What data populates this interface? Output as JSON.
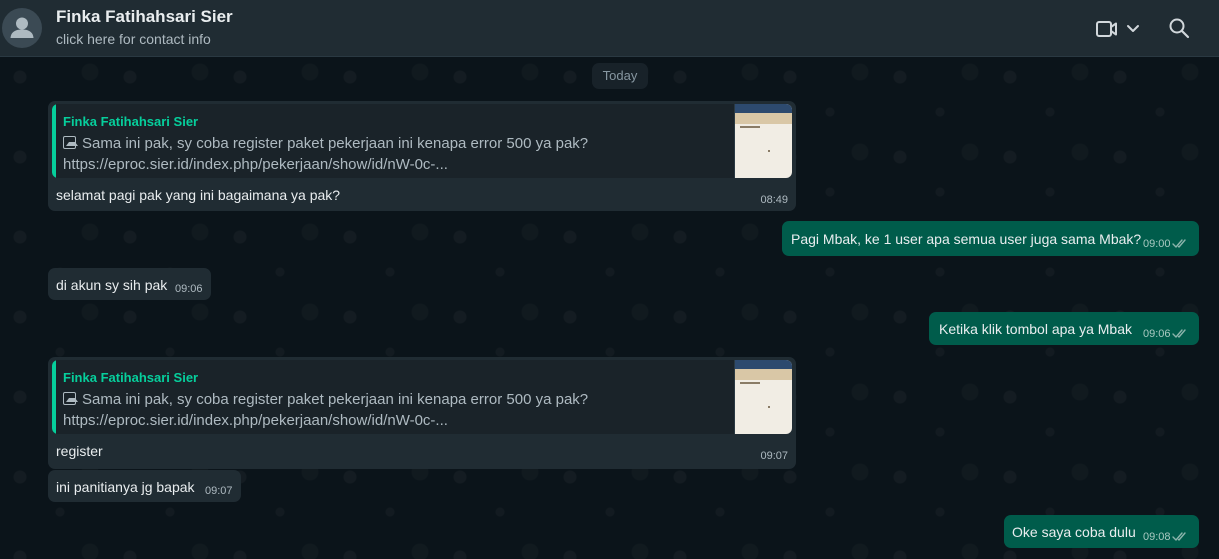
{
  "header": {
    "contact_name": "Finka Fatihahsari Sier",
    "subtitle": "click here for contact info",
    "icons": [
      "avatar-icon",
      "video-call-icon",
      "chevron-down-icon",
      "search-icon"
    ]
  },
  "chat": {
    "date_label": "Today",
    "messages": [
      {
        "direction": "in",
        "quote": {
          "author": "Finka Fatihahsari Sier",
          "text": "Sama ini pak, sy coba register paket pekerjaan ini kenapa error 500 ya pak?",
          "link": "https://eproc.sier.id/index.php/pekerjaan/show/id/nW-0c-..."
        },
        "text": "selamat pagi pak yang ini bagaimana ya pak?",
        "time": "08:49"
      },
      {
        "direction": "out",
        "text": "Pagi Mbak, ke 1 user apa semua user juga sama Mbak?",
        "time": "09:00"
      },
      {
        "direction": "in",
        "text": "di akun sy sih pak",
        "time": "09:06"
      },
      {
        "direction": "out",
        "text": "Ketika klik tombol apa ya Mbak",
        "time": "09:06"
      },
      {
        "direction": "in",
        "quote": {
          "author": "Finka Fatihahsari Sier",
          "text": "Sama ini pak, sy coba register paket pekerjaan ini kenapa error 500 ya pak?",
          "link": "https://eproc.sier.id/index.php/pekerjaan/show/id/nW-0c-..."
        },
        "text": "register",
        "time": "09:07"
      },
      {
        "direction": "in",
        "text": "ini panitianya jg bapak",
        "time": "09:07"
      },
      {
        "direction": "out",
        "text": "Oke saya coba dulu",
        "time": "09:08"
      }
    ]
  },
  "colors": {
    "header_bg": "#202c33",
    "chat_bg": "#0b141a",
    "incoming_bubble": "#202c33",
    "outgoing_bubble": "#005c4b",
    "quote_accent": "#06cf9c",
    "read_ticks": "#8bb4ab"
  }
}
